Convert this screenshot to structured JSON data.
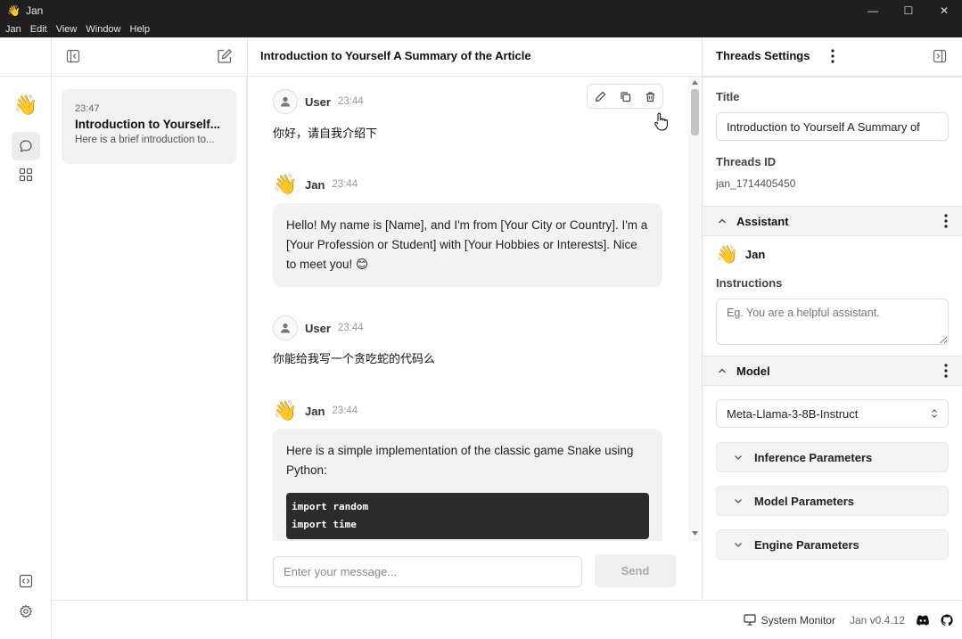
{
  "window": {
    "app_icon": "👋",
    "title": "Jan",
    "min": "—",
    "max": "☐",
    "close": "✕"
  },
  "menu": [
    "Jan",
    "Edit",
    "View",
    "Window",
    "Help"
  ],
  "rail": {
    "logo": "👋"
  },
  "thread_list": [
    {
      "time": "23:47",
      "title": "Introduction to Yourself...",
      "summary": "Here is a brief introduction to..."
    }
  ],
  "chat": {
    "title": "Introduction to Yourself A Summary of the Article",
    "messages": [
      {
        "author": "User",
        "time": "23:44",
        "text": "你好，请自我介绍下"
      },
      {
        "author": "Jan",
        "avatar": "👋",
        "time": "23:44",
        "text": "Hello! My name is [Name], and I'm from [Your City or Country]. I'm a [Your Profession or Student] with [Your Hobbies or Interests]. Nice to meet you! 😊"
      },
      {
        "author": "User",
        "time": "23:44",
        "text": "你能给我写一个贪吃蛇的代码么"
      },
      {
        "author": "Jan",
        "avatar": "👋",
        "time": "23:44",
        "text": "Here is a simple implementation of the classic game Snake using Python:",
        "code": [
          "import random",
          "import time"
        ]
      }
    ],
    "input_placeholder": "Enter your message...",
    "send_label": "Send"
  },
  "settings": {
    "header": "Threads Settings",
    "title_label": "Title",
    "title_value": "Introduction to Yourself A Summary of",
    "id_label": "Threads ID",
    "id_value": "jan_1714405450",
    "assistant_section": "Assistant",
    "assistant_avatar": "👋",
    "assistant_name": "Jan",
    "instructions_label": "Instructions",
    "instructions_placeholder": "Eg. You are a helpful assistant.",
    "model_section": "Model",
    "model_value": "Meta-Llama-3-8B-Instruct",
    "accordions": [
      "Inference Parameters",
      "Model Parameters",
      "Engine Parameters"
    ]
  },
  "status": {
    "monitor": "System Monitor",
    "version": "Jan v0.4.12"
  }
}
